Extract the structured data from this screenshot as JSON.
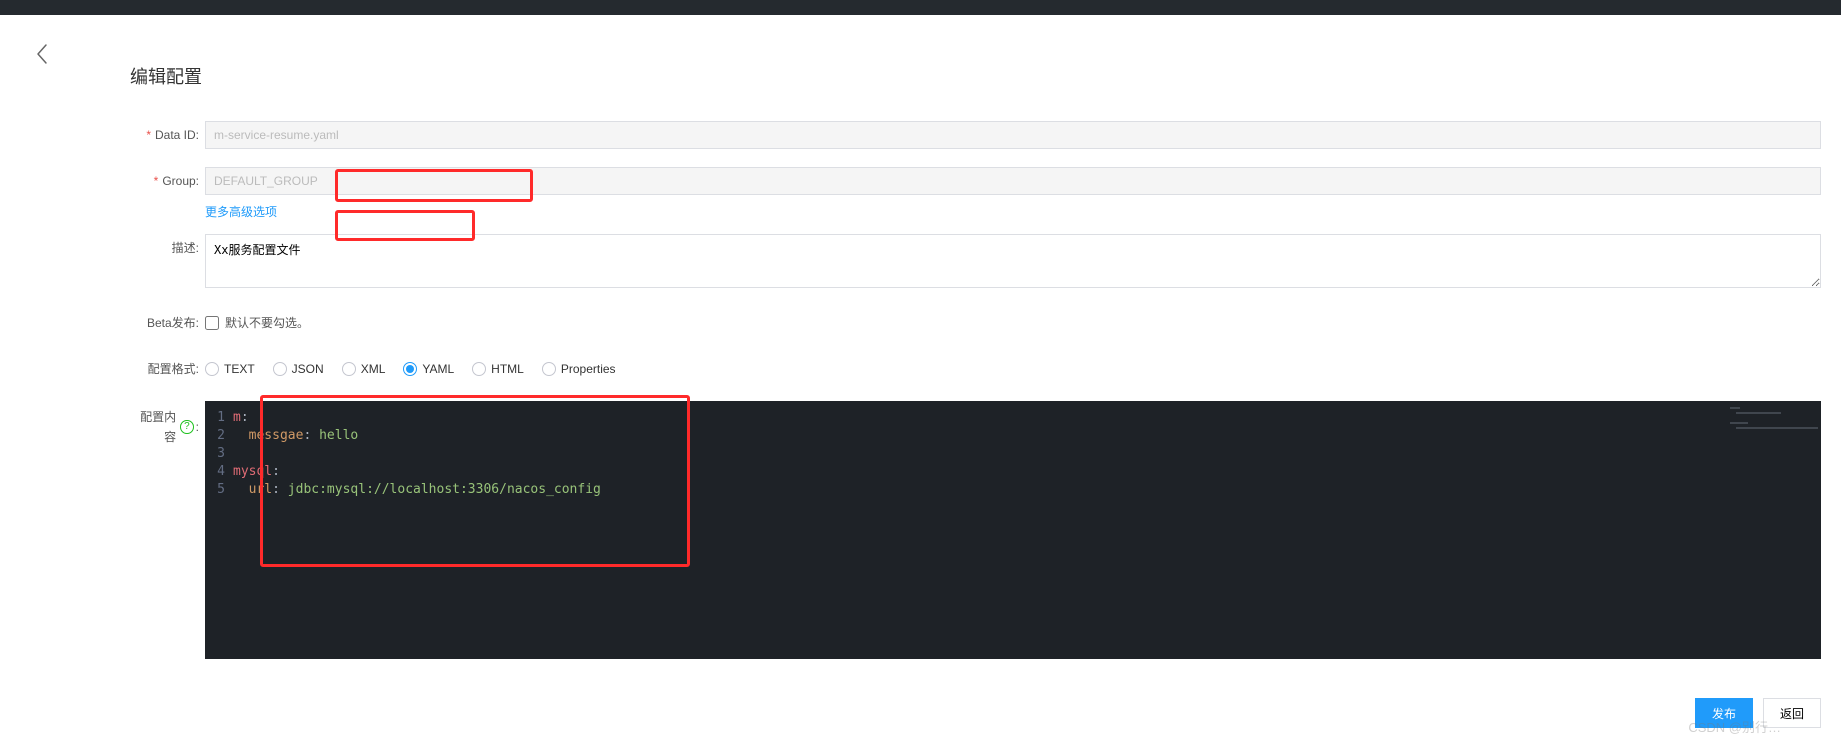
{
  "page_title": "编辑配置",
  "labels": {
    "data_id": "Data ID:",
    "group": "Group:",
    "more_options": "更多高级选项",
    "description": "描述:",
    "beta_publish": "Beta发布:",
    "beta_checkbox_text": "默认不要勾选。",
    "config_format": "配置格式:",
    "config_content": "配置内容",
    "colon": ":"
  },
  "fields": {
    "data_id_value": "m-service-resume.yaml",
    "group_value": "DEFAULT_GROUP",
    "description_value": "Xx服务配置文件",
    "beta_checked": false
  },
  "formats": {
    "options": [
      "TEXT",
      "JSON",
      "XML",
      "YAML",
      "HTML",
      "Properties"
    ],
    "selected": "YAML"
  },
  "editor_lines": [
    {
      "n": 1,
      "tokens": [
        {
          "t": "m",
          "c": "tok-key"
        },
        {
          "t": ":",
          "c": "tok-punct"
        }
      ]
    },
    {
      "n": 2,
      "tokens": [
        {
          "t": "  ",
          "c": ""
        },
        {
          "t": "messgae",
          "c": "tok-attr"
        },
        {
          "t": ": ",
          "c": "tok-punct"
        },
        {
          "t": "hello",
          "c": "tok-str"
        }
      ]
    },
    {
      "n": 3,
      "tokens": []
    },
    {
      "n": 4,
      "tokens": [
        {
          "t": "mysql",
          "c": "tok-key"
        },
        {
          "t": ":",
          "c": "tok-punct"
        }
      ]
    },
    {
      "n": 5,
      "tokens": [
        {
          "t": "  ",
          "c": ""
        },
        {
          "t": "url",
          "c": "tok-attr"
        },
        {
          "t": ": ",
          "c": "tok-punct"
        },
        {
          "t": "jdbc:mysql://localhost:3306/nacos_config",
          "c": "tok-str"
        }
      ]
    }
  ],
  "buttons": {
    "publish": "发布",
    "back": "返回"
  },
  "help_badge": "?",
  "watermark": "CSDN @别行…"
}
